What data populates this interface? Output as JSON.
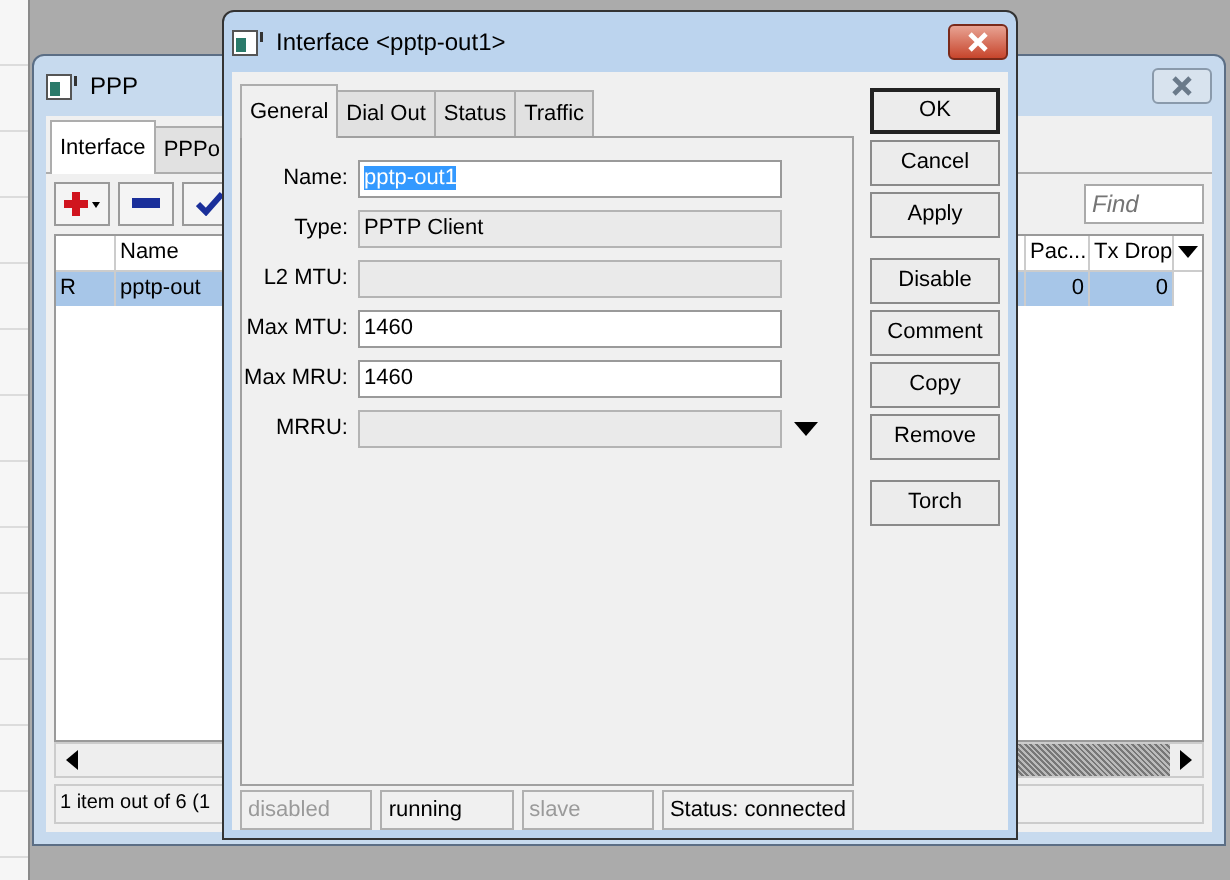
{
  "ppp_window": {
    "title": "PPP",
    "tabs": [
      {
        "label": "Interface",
        "selected": true
      },
      {
        "label": "PPPo",
        "selected": false
      }
    ],
    "find": {
      "placeholder": "Find"
    },
    "table": {
      "columns": [
        {
          "label": "Name"
        },
        {
          "label": "Pac..."
        },
        {
          "label": "Tx Drop"
        }
      ],
      "rows": [
        {
          "flag": "R",
          "name": "pptp-out",
          "packets": "0",
          "tx_drop": "0",
          "selected": true
        }
      ]
    },
    "status_bar": "1 item out of 6 (1"
  },
  "dialog": {
    "title": "Interface <pptp-out1>",
    "tabs": [
      {
        "label": "General",
        "selected": true
      },
      {
        "label": "Dial Out",
        "selected": false
      },
      {
        "label": "Status",
        "selected": false
      },
      {
        "label": "Traffic",
        "selected": false
      }
    ],
    "fields": [
      {
        "label": "Name:",
        "value": "pptp-out1",
        "kind": "text",
        "disabled": false,
        "highlighted": true
      },
      {
        "label": "Type:",
        "value": "PPTP Client",
        "kind": "text",
        "disabled": true,
        "highlighted": false
      },
      {
        "label": "L2 MTU:",
        "kind": "text",
        "disabled": true
      },
      {
        "label": "Max MTU:",
        "value": "1460",
        "kind": "text",
        "disabled": false,
        "highlighted": false
      },
      {
        "label": "Max MRU:",
        "value": "1460",
        "kind": "text",
        "disabled": false,
        "highlighted": false
      },
      {
        "label": "MRRU:",
        "kind": "dropdown",
        "disabled": true
      }
    ],
    "button_groups": [
      [
        {
          "label": "OK",
          "default": true
        },
        {
          "label": "Cancel",
          "default": false
        },
        {
          "label": "Apply",
          "default": false
        }
      ],
      [
        {
          "label": "Disable",
          "default": false
        },
        {
          "label": "Comment",
          "default": false
        },
        {
          "label": "Copy",
          "default": false
        },
        {
          "label": "Remove",
          "default": false
        }
      ],
      [
        {
          "label": "Torch",
          "default": false
        }
      ]
    ],
    "status_bar": [
      {
        "text": "disabled",
        "dimmed": true
      },
      {
        "text": "running",
        "dimmed": false
      },
      {
        "text": "slave",
        "dimmed": true
      },
      {
        "text": "Status: connected",
        "dimmed": false
      }
    ]
  }
}
